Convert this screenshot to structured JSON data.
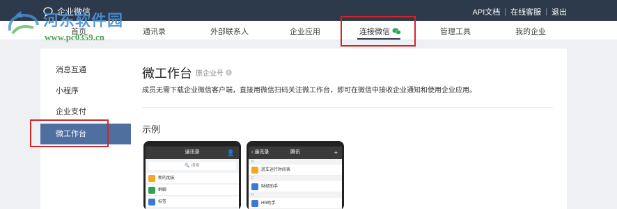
{
  "header": {
    "brand": "企业微信",
    "links": [
      "API文档",
      "在线客服",
      "退出"
    ]
  },
  "nav": {
    "items": [
      "首页",
      "通讯录",
      "外部联系人",
      "企业应用",
      "连接微信",
      "管理工具",
      "我的企业"
    ],
    "active_index": 4
  },
  "sidebar": {
    "items": [
      "消息互通",
      "小程序",
      "企业支付",
      "微工作台"
    ],
    "active_index": 3
  },
  "main": {
    "title": "微工作台",
    "title_sub": "原企业号",
    "description": "成员无需下载企业微信客户端，直接用微信扫码关注微工作台，即可在微信中接收企业通知和使用企业应用。",
    "example_title": "示例"
  },
  "phone1": {
    "header": "通讯录",
    "search_placeholder": "搜索",
    "rows": [
      "新的朋友",
      "群聊",
      "标签"
    ],
    "row_colors": [
      "#f5a623",
      "#2fa44f",
      "#3b7bd4"
    ]
  },
  "phone2": {
    "back_label": "通讯录",
    "header": "腾讯",
    "letters": [
      "B",
      "C",
      "H"
    ],
    "rows": [
      "班车运行时间表",
      "财经助手",
      "HR助手"
    ],
    "row_colors": [
      "#f5a623",
      "#3b7bd4",
      "#3b7bd4"
    ]
  },
  "watermark": {
    "text": "河东软件园",
    "url": "www.pc0359.cn"
  },
  "colors": {
    "topbar": "#2d3a4b",
    "sidebar_active": "#4f6fa0",
    "highlight": "#d0262b",
    "wechat_green": "#2fa44f"
  }
}
